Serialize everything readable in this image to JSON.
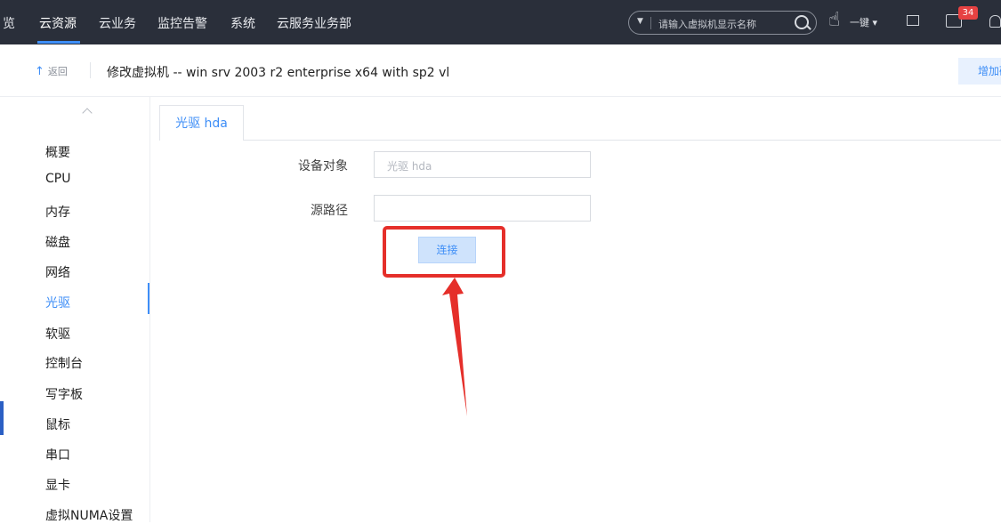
{
  "topnav": {
    "items": [
      "览",
      "云资源",
      "云业务",
      "监控告警",
      "系统",
      "云服务业务部"
    ],
    "active_index": 1,
    "search": {
      "placeholder": "请输入虚拟机显示名称",
      "dropdown_icon": "caret-down-icon"
    },
    "onekey_label": "一键 ▾",
    "badge_count": "34"
  },
  "header": {
    "back_label": "返回",
    "back_icon": "↑",
    "title": "修改虚拟机 -- win srv 2003 r2 enterprise x64 with sp2 vl",
    "add_button_label": "增加硬"
  },
  "sidebar": {
    "items": [
      "概要",
      "CPU",
      "内存",
      "磁盘",
      "网络",
      "光驱",
      "软驱",
      "控制台",
      "写字板",
      "鼠标",
      "串口",
      "显卡",
      "虚拟NUMA设置"
    ],
    "active": "光驱"
  },
  "tab": {
    "label": "光驱 hda"
  },
  "form": {
    "device_label": "设备对象",
    "device_value": "光驱 hda",
    "path_label": "源路径",
    "path_value": "",
    "connect_label": "连接"
  },
  "colors": {
    "accent": "#3e8ef7",
    "topbar": "#2a2f3a",
    "annotation": "#e52f2a"
  }
}
